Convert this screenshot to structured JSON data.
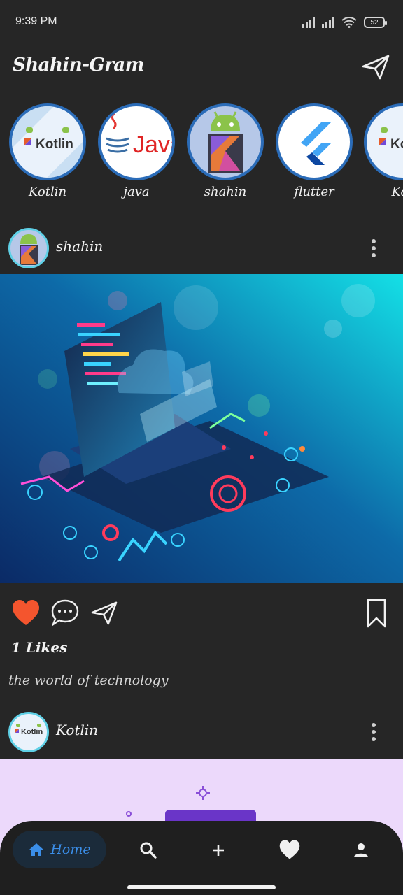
{
  "status": {
    "time": "9:39 PM",
    "battery": "52"
  },
  "app": {
    "title": "Shahin-Gram"
  },
  "stories": [
    {
      "label": "Kotlin",
      "logo_text": "Kotlin"
    },
    {
      "label": "java",
      "logo_text": "Java"
    },
    {
      "label": "shahin"
    },
    {
      "label": "flutter"
    },
    {
      "label": "Kot",
      "logo_text": "Ko"
    }
  ],
  "posts": [
    {
      "user": "shahin",
      "likes": "1 Likes",
      "caption": "the world of technology"
    },
    {
      "user": "Kotlin",
      "logo_text": "Kotlin"
    }
  ],
  "nav": {
    "home_label": "Home"
  },
  "icons": {
    "send": "paper-plane-icon",
    "more": "three-dots-vertical-icon",
    "like": "heart-icon",
    "comment": "speech-bubble-icon",
    "share": "paper-plane-icon",
    "save": "bookmark-icon",
    "home": "home-icon",
    "search": "search-icon",
    "add": "plus-icon",
    "activity": "heart-icon",
    "profile": "person-icon"
  },
  "colors": {
    "background": "#262626",
    "like": "#f4552e",
    "nav_active": "#3b8ee8",
    "story_ring": "#2b6cb8"
  }
}
